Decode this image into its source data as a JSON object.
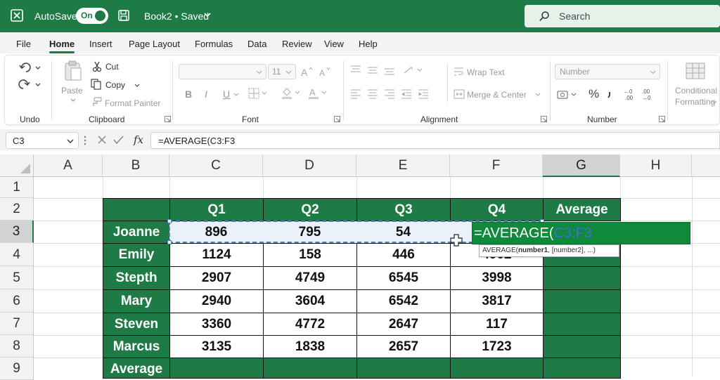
{
  "titlebar": {
    "autosave_label": "AutoSave",
    "autosave_toggle": "On",
    "book_title": "Book2 • Saved",
    "search_placeholder": "Search"
  },
  "menu": [
    "File",
    "Home",
    "Insert",
    "Page Layout",
    "Formulas",
    "Data",
    "Review",
    "View",
    "Help"
  ],
  "menu_active": "Home",
  "ribbon": {
    "undo_group": "Undo",
    "clipboard": {
      "paste": "Paste",
      "cut": "Cut",
      "copy": "Copy",
      "format_painter": "Format Painter",
      "group": "Clipboard"
    },
    "font": {
      "size": "11",
      "group": "Font",
      "bold": "B",
      "italic": "I",
      "underline": "U"
    },
    "alignment": {
      "wrap_text": "Wrap Text",
      "merge_center": "Merge & Center",
      "group": "Alignment"
    },
    "number": {
      "format": "Number",
      "percent": "%",
      "group": "Number"
    },
    "styles": {
      "conditional": "Conditional",
      "formatting": "Formatting"
    }
  },
  "formula_bar": {
    "name_box": "C3",
    "fx": "fx",
    "formula": "=AVERAGE(C3:F3"
  },
  "columns": [
    "A",
    "B",
    "C",
    "D",
    "E",
    "F",
    "G",
    "H"
  ],
  "selected_column": "G",
  "rows": [
    "1",
    "2",
    "3",
    "4",
    "5",
    "6",
    "7",
    "8",
    "9"
  ],
  "selected_row": "3",
  "table": {
    "headers": [
      "Q1",
      "Q2",
      "Q3",
      "Q4",
      "Average"
    ],
    "names": [
      "Joanne",
      "Emily",
      "Stepth",
      "Mary",
      "Steven",
      "Marcus",
      "Average"
    ],
    "values": [
      [
        "896",
        "795",
        "54",
        ""
      ],
      [
        "1124",
        "158",
        "446",
        "4902"
      ],
      [
        "2907",
        "4749",
        "6545",
        "3998"
      ],
      [
        "2940",
        "3604",
        "6542",
        "3817"
      ],
      [
        "3360",
        "4772",
        "2647",
        "117"
      ],
      [
        "3135",
        "1838",
        "2657",
        "1723"
      ]
    ]
  },
  "edit_cell": {
    "prefix": "=AVERAGE(",
    "ref": "C3:F3"
  },
  "tooltip": {
    "fn": "AVERAGE(",
    "arg1": "number1",
    "rest": ", [number2], ...)"
  },
  "colors": {
    "excel_green": "#1e7b45",
    "edit_green": "#0f8a3a",
    "ref_blue": "#3f6fd6"
  }
}
